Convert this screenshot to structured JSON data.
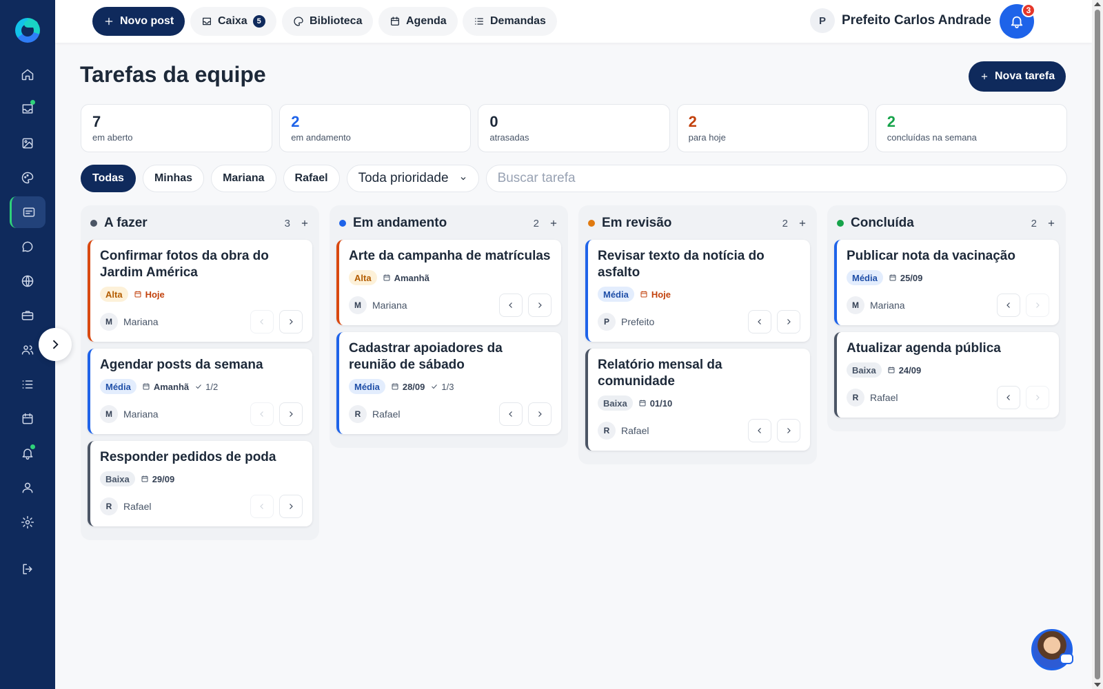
{
  "topbar": {
    "new_post": "Novo post",
    "inbox": "Caixa",
    "inbox_count": "5",
    "library": "Biblioteca",
    "agenda": "Agenda",
    "demands": "Demandas",
    "user_initial": "P",
    "user_name": "Prefeito Carlos Andrade",
    "notifications_count": "3"
  },
  "sidebar": {
    "items": [
      "home-icon",
      "inbox-icon",
      "image-icon",
      "palette-icon",
      "tasks-icon",
      "chat-icon",
      "globe-icon",
      "briefcase-icon",
      "users-icon",
      "list-icon",
      "calendar-icon",
      "bell-icon",
      "user-icon",
      "settings-icon",
      "logout-icon"
    ],
    "active": "tasks-icon",
    "accent": "#2fd27a"
  },
  "page": {
    "title": "Tarefas da equipe",
    "new_task": "Nova tarefa"
  },
  "stats": [
    {
      "value": "7",
      "label": "em aberto",
      "color": "#1d2939"
    },
    {
      "value": "2",
      "label": "em andamento",
      "color": "#1e63e9"
    },
    {
      "value": "0",
      "label": "atrasadas",
      "color": "#1d2939"
    },
    {
      "value": "2",
      "label": "para hoje",
      "color": "#c2410c"
    },
    {
      "value": "2",
      "label": "concluídas na semana",
      "color": "#16a34a"
    }
  ],
  "filters": {
    "chips": [
      "Todas",
      "Minhas",
      "Mariana",
      "Rafael"
    ],
    "active": "Todas",
    "priority": "Toda prioridade",
    "search_placeholder": "Buscar tarefa"
  },
  "columns": [
    {
      "title": "A fazer",
      "count": "3",
      "dot": "#4b5565",
      "cards": [
        {
          "title": "Confirmar fotos da obra do Jardim América",
          "priority": "Alta",
          "date": "Hoje",
          "initial": "M",
          "assignee": "Mariana"
        },
        {
          "title": "Agendar posts da semana",
          "priority": "Média",
          "date": "Amanhã",
          "checklist": "1/2",
          "initial": "M",
          "assignee": "Mariana"
        },
        {
          "title": "Responder pedidos de poda",
          "priority": "Baixa",
          "date": "29/09",
          "initial": "R",
          "assignee": "Rafael"
        }
      ]
    },
    {
      "title": "Em andamento",
      "count": "2",
      "dot": "#1e63e9",
      "cards": [
        {
          "title": "Arte da campanha de matrículas",
          "priority": "Alta",
          "date": "Amanhã",
          "initial": "M",
          "assignee": "Mariana"
        },
        {
          "title": "Cadastrar apoiadores da reunião de sábado",
          "priority": "Média",
          "date": "28/09",
          "checklist": "1/3",
          "initial": "R",
          "assignee": "Rafael"
        }
      ]
    },
    {
      "title": "Em revisão",
      "count": "2",
      "dot": "#e07a10",
      "cards": [
        {
          "title": "Revisar texto da notícia do asfalto",
          "priority": "Média",
          "date": "Hoje",
          "initial": "P",
          "assignee": "Prefeito"
        },
        {
          "title": "Relatório mensal da comunidade",
          "priority": "Baixa",
          "date": "01/10",
          "initial": "R",
          "assignee": "Rafael"
        }
      ]
    },
    {
      "title": "Concluída",
      "count": "2",
      "dot": "#16a34a",
      "cards": [
        {
          "title": "Publicar nota da vacinação",
          "priority": "Média",
          "date": "25/09",
          "initial": "M",
          "assignee": "Mariana"
        },
        {
          "title": "Atualizar agenda pública",
          "priority": "Baixa",
          "date": "24/09",
          "initial": "R",
          "assignee": "Rafael"
        }
      ]
    }
  ],
  "colors": {
    "navy": "#0f2a5c",
    "alta_border": "#d9480f",
    "media_border": "#1e63e9",
    "baixa_border": "#4b5565"
  }
}
